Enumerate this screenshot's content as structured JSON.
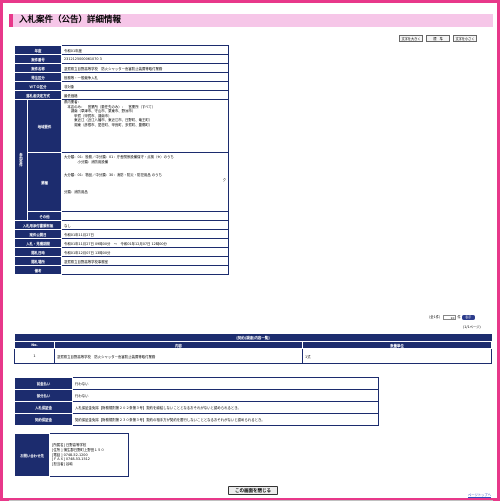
{
  "page": {
    "title": "入札案件（公告）詳細情報",
    "text_size_buttons": [
      "文字を大きく",
      "標　準",
      "文字を小さく"
    ]
  },
  "details": {
    "nendo": {
      "label": "年度",
      "value": "令和01年度"
    },
    "anken_no": {
      "label": "案件番号",
      "value": "2312125000061070 3"
    },
    "anken_name": {
      "label": "案件名称",
      "value": "滋賀県立目野高等学校　防火シャッター危害防止装置等取付業務"
    },
    "kashosho": {
      "label": "発注区分",
      "value": "役務等・一般競争入札"
    },
    "wto": {
      "label": "ＷＴＯ区分",
      "value": "非対象"
    },
    "rakusatsu": {
      "label": "落札者決定方式",
      "value": "最低価格"
    },
    "sanka_group": "参加条件",
    "chiiki": {
      "label": "地域要件",
      "value": "県内業者：\n　本店のみ：　営業所（委任先のみ）：　営業所（すべて）\n　　湖南（草津市、守山市、栗東市、野洲市）\n　　　甲賀（甲賀市、湖南市）\n　　　東近江（近江八幡市、東近江市、日野町、竜王町）\n　　　湖東（彦根市、愛荘町、甲良町、多賀町、豊郷町）"
    },
    "gyoshu": {
      "label": "業種",
      "line1": "大分類：01：役務／中分類：01：庁舎関係設備保守・点検（※）のうち",
      "line1b": "　　　　小分類：消防用設備",
      "line2": "大分類：01：物品／中分類：30：消防・防災・防犯用品 のうち",
      "line2b": "ク",
      "line3": "分類：消防用品"
    },
    "sonota": {
      "label": "その他",
      "value": ""
    },
    "tenpu": {
      "label": "入札用添付書類有無",
      "value": "なし"
    },
    "koukoku_date": {
      "label": "案件公開日",
      "value": "令和01年11月27日"
    },
    "uketsuke": {
      "label": "入札・見積期間",
      "value": "令和01年11月27日 09時00分　〜　令和01年12月07日 12時00分"
    },
    "kaisatsu": {
      "label": "開札日時",
      "value": "令和01年12月07日 13時00分"
    },
    "basho": {
      "label": "開札場所",
      "value": "滋賀県立目野高等学校事務室"
    },
    "biko": {
      "label": "備考",
      "value": ""
    }
  },
  "pager": {
    "prefix": "（全1件）",
    "select_value": "10",
    "select_suffix": "件",
    "go_label": "表示",
    "count_text": "(1/1ページ)"
  },
  "contract": {
    "caption": "[契約(調達)内容一覧]",
    "headers": [
      "No.",
      "内容",
      "数量単位"
    ],
    "rows": [
      {
        "no": "1",
        "content": "滋賀県立目野高等学校　防火シャッター危害防止装置等取付業務",
        "qty": "1式"
      }
    ]
  },
  "bid_conditions": [
    {
      "label": "前金払い",
      "value": "行わない"
    },
    {
      "label": "部分払い",
      "value": "行わない"
    },
    {
      "label": "入札保証金",
      "value": "入札保証金免除【財務規則第２０２条第３号】契約を締結しないこととなるおそれがないと認められるとき。"
    },
    {
      "label": "契約保証金",
      "value": "契約保証金免除【財務規則第２３０条第３号】契約の相手方が契約を履行しないこととなるおそれがないと認められるとき。"
    }
  ],
  "inquiry": {
    "label": "お問い合わせ先",
    "lines": [
      "[所属名] 日野高等学校",
      "[住所 ] 蒲生郡日野町上野田１５０",
      "[電話 ] 0748-52-1200",
      "[ＦＡＸ] 0748-53-1512",
      "[担当者] 谷嶋"
    ]
  },
  "close_button": "この画面を閉じる",
  "page_top_link": "ページトップへ",
  "colors": {
    "border_pink": "#e8388a",
    "title_bg": "#f6c6e8",
    "header_navy": "#1c2c6e"
  }
}
